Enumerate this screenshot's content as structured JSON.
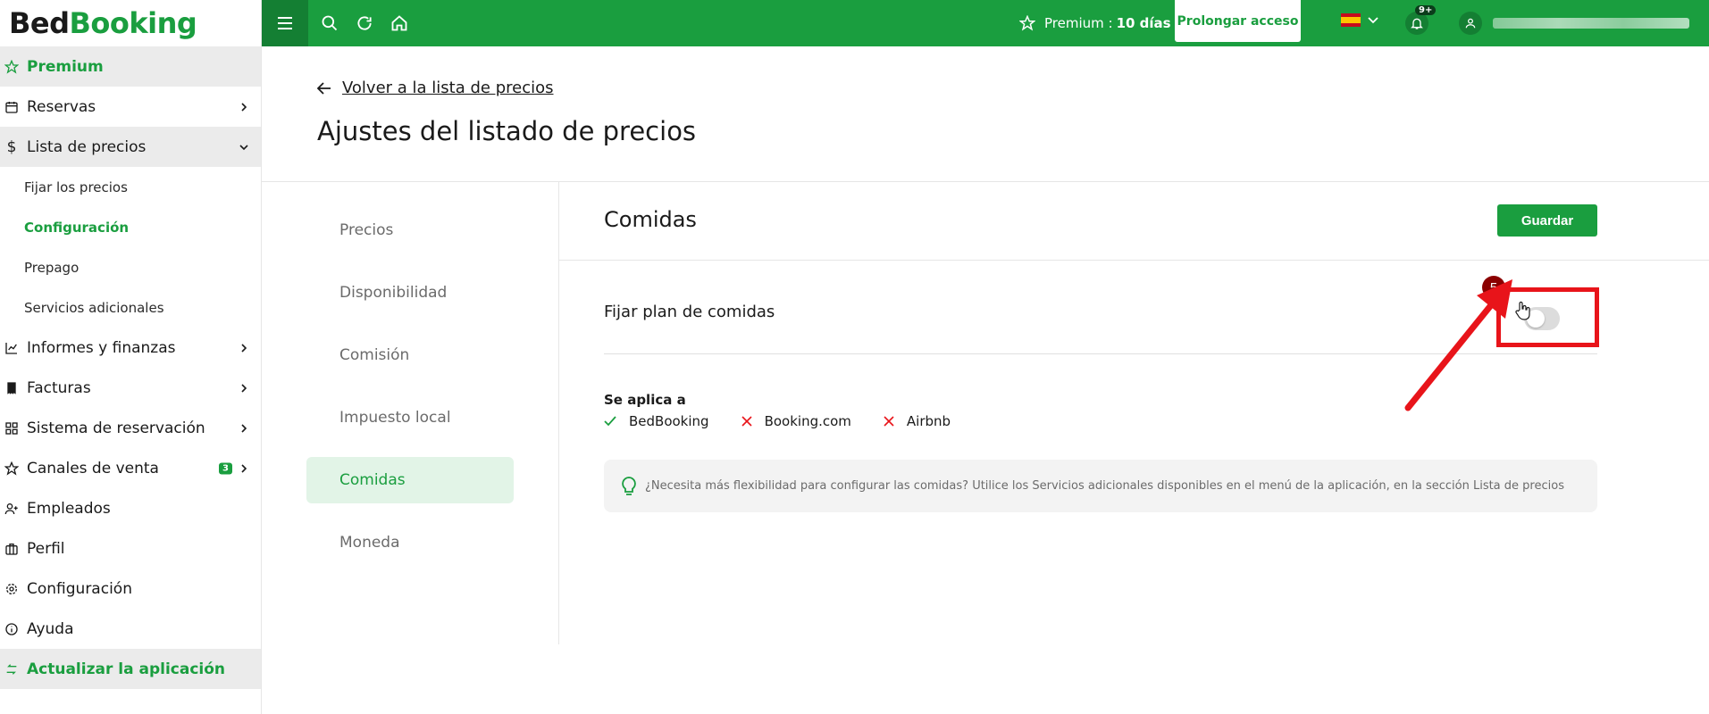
{
  "app": {
    "logo_part1": "Bed",
    "logo_part2": "Booking"
  },
  "topbar": {
    "premium_label": "Premium :",
    "premium_days": "10 días",
    "prolong_button": "Prolongar acceso",
    "notifications_count": "9+"
  },
  "sidebar": {
    "items": [
      {
        "label": "Premium",
        "icon": "star-icon"
      },
      {
        "label": "Reservas",
        "icon": "calendar-icon"
      },
      {
        "label": "Lista de precios",
        "icon": "dollar-icon"
      },
      {
        "label": "Informes y finanzas",
        "icon": "chart-icon"
      },
      {
        "label": "Facturas",
        "icon": "invoice-icon"
      },
      {
        "label": "Sistema de reservación",
        "icon": "grid-icon"
      },
      {
        "label": "Canales de venta",
        "icon": "star-icon",
        "badge": "3"
      },
      {
        "label": "Empleados",
        "icon": "user-plus-icon"
      },
      {
        "label": "Perfil",
        "icon": "briefcase-icon"
      },
      {
        "label": "Configuración",
        "icon": "gear-icon"
      },
      {
        "label": "Ayuda",
        "icon": "info-icon"
      },
      {
        "label": "Actualizar la aplicación",
        "icon": "refresh-icon"
      }
    ],
    "subitems": [
      {
        "label": "Fijar los precios"
      },
      {
        "label": "Configuración"
      },
      {
        "label": "Prepago"
      },
      {
        "label": "Servicios adicionales"
      }
    ]
  },
  "main": {
    "back_link": "Volver a la lista de precios",
    "page_title": "Ajustes del listado de precios",
    "tabs": [
      {
        "label": "Precios"
      },
      {
        "label": "Disponibilidad"
      },
      {
        "label": "Comisión"
      },
      {
        "label": "Impuesto local"
      },
      {
        "label": "Comidas"
      },
      {
        "label": "Moneda"
      }
    ],
    "section_title": "Comidas",
    "save_button": "Guardar",
    "meal_plan_label": "Fijar plan de comidas",
    "meal_plan_enabled": false,
    "step_number": "5",
    "applies_to_title": "Se aplica a",
    "channels": [
      {
        "name": "BedBooking",
        "applies": true
      },
      {
        "name": "Booking.com",
        "applies": false
      },
      {
        "name": "Airbnb",
        "applies": false
      }
    ],
    "tip_text": "¿Necesita más flexibilidad para configurar las comidas? Utilice los Servicios adicionales disponibles en el menú de la aplicación, en la sección Lista de precios"
  },
  "colors": {
    "brand_green": "#1a9e3f",
    "highlight_red": "#e8141a"
  }
}
